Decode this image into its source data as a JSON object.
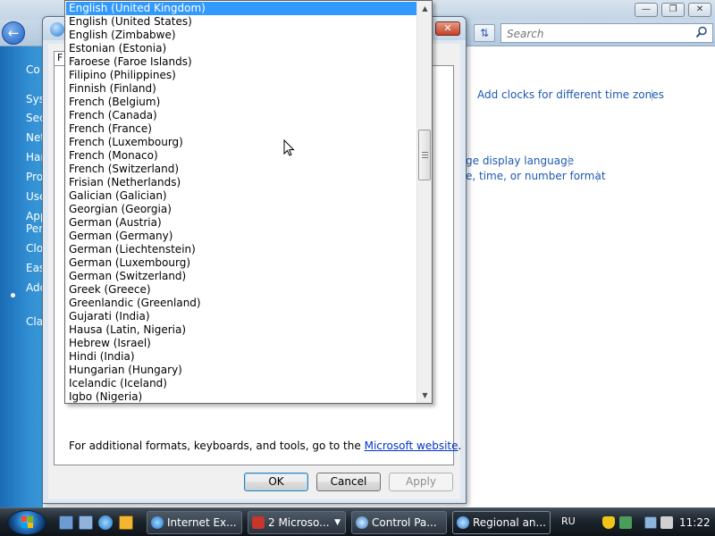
{
  "control_panel": {
    "search_placeholder": "Search",
    "nav_items": [
      "Co",
      "Sys",
      "Sec",
      "Net",
      "Har",
      "Pro",
      "Use",
      "App",
      "Per",
      "Clo",
      "Eas",
      "Add",
      "Cla"
    ],
    "links": {
      "add_clocks": "Add clocks for different time zones",
      "display_language": "ge display language",
      "time_number_format": "e, time, or number format"
    }
  },
  "dialog": {
    "tab_stub": "F",
    "additional_text": "For additional formats, keyboards, and tools, go to the",
    "additional_link": "Microsoft website",
    "additional_period": ".",
    "buttons": {
      "ok": "OK",
      "cancel": "Cancel",
      "apply": "Apply"
    }
  },
  "dropdown": {
    "selected_index": 0,
    "items": [
      "English (United Kingdom)",
      "English (United States)",
      "English (Zimbabwe)",
      "Estonian (Estonia)",
      "Faroese (Faroe Islands)",
      "Filipino (Philippines)",
      "Finnish (Finland)",
      "French (Belgium)",
      "French (Canada)",
      "French (France)",
      "French (Luxembourg)",
      "French (Monaco)",
      "French (Switzerland)",
      "Frisian (Netherlands)",
      "Galician (Galician)",
      "Georgian (Georgia)",
      "German (Austria)",
      "German (Germany)",
      "German (Liechtenstein)",
      "German (Luxembourg)",
      "German (Switzerland)",
      "Greek (Greece)",
      "Greenlandic (Greenland)",
      "Gujarati (India)",
      "Hausa (Latin, Nigeria)",
      "Hebrew (Israel)",
      "Hindi (India)",
      "Hungarian (Hungary)",
      "Icelandic (Iceland)",
      "Igbo (Nigeria)"
    ]
  },
  "taskbar": {
    "tasks": [
      {
        "label": "Internet Ex...",
        "icon": "internet-explorer-icon"
      },
      {
        "label": "2 Microso...",
        "icon": "word-icon"
      },
      {
        "label": "Control Pa...",
        "icon": "control-panel-icon"
      },
      {
        "label": "Regional an...",
        "icon": "regional-icon"
      }
    ],
    "language": "RU",
    "time": "11:22"
  },
  "colors": {
    "selection": "#3399ff",
    "link": "#1e58b4",
    "nav_bg": "#2f8bd1",
    "taskbar_bg": "#1c242c"
  }
}
